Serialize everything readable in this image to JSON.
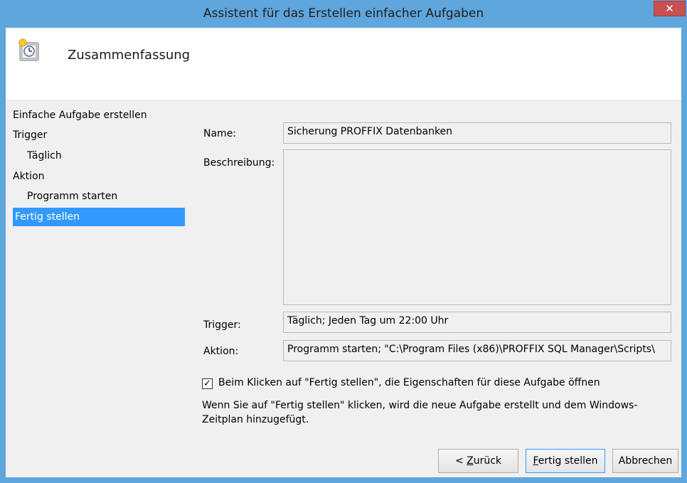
{
  "window": {
    "title": "Assistent für das Erstellen einfacher Aufgaben",
    "close_glyph": "✕"
  },
  "header": {
    "title": "Zusammenfassung",
    "icon": "task-scheduler-icon"
  },
  "nav": {
    "items": [
      {
        "label": "Einfache Aufgabe erstellen",
        "indent": false,
        "selected": false
      },
      {
        "label": "Trigger",
        "indent": false,
        "selected": false
      },
      {
        "label": "Täglich",
        "indent": true,
        "selected": false
      },
      {
        "label": "Aktion",
        "indent": false,
        "selected": false
      },
      {
        "label": "Programm starten",
        "indent": true,
        "selected": false
      },
      {
        "label": "Fertig stellen",
        "indent": false,
        "selected": true
      }
    ]
  },
  "summary": {
    "name_label": "Name:",
    "name_value": "Sicherung PROFFIX Datenbanken",
    "description_label": "Beschreibung:",
    "description_value": "",
    "trigger_label": "Trigger:",
    "trigger_value": "Täglich; Jeden Tag um 22:00 Uhr",
    "action_label": "Aktion:",
    "action_value": "Programm starten; \"C:\\Program Files (x86)\\PROFFIX SQL Manager\\Scripts\\"
  },
  "open_properties": {
    "checked": true,
    "label": "Beim Klicken auf \"Fertig stellen\", die Eigenschaften für diese Aufgabe öffnen"
  },
  "info_text": "Wenn Sie auf \"Fertig stellen\" klicken, wird die neue Aufgabe erstellt und dem Windows-Zeitplan hinzugefügt.",
  "buttons": {
    "back_prefix": "< ",
    "back_mnemonic": "Z",
    "back_rest": "urück",
    "finish_mnemonic": "F",
    "finish_rest": "ertig stellen",
    "cancel": "Abbrechen"
  },
  "colors": {
    "titlebar": "#5ea6dc",
    "selection": "#3399ff",
    "close": "#c75050"
  }
}
